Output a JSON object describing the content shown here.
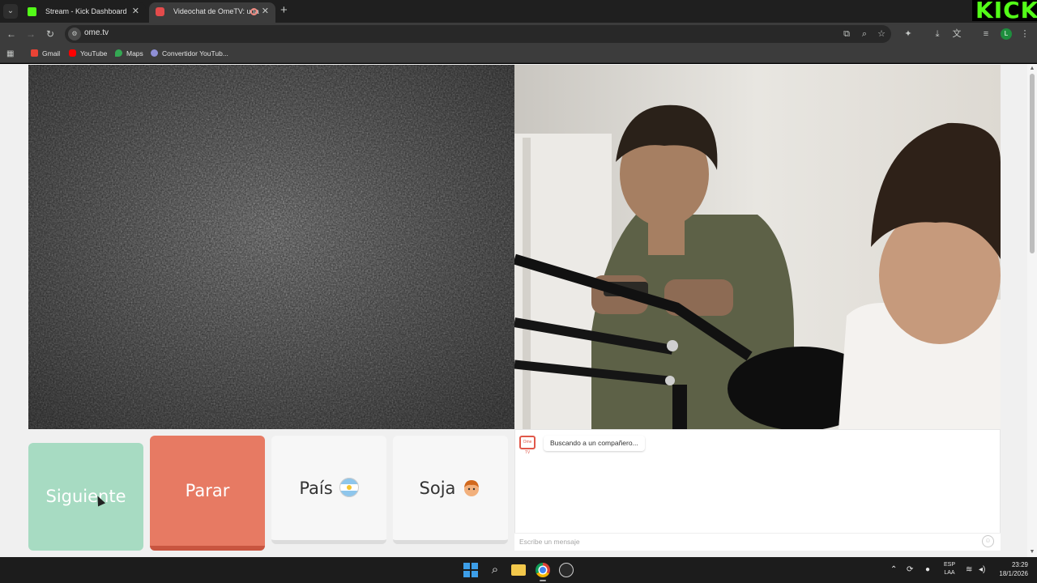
{
  "browser": {
    "tabs": [
      {
        "title": "Stream - Kick Dashboard",
        "active": false
      },
      {
        "title": "Videochat de OmeTV: una",
        "active": true
      }
    ],
    "url": "ome.tv",
    "bookmarks": [
      "Gmail",
      "YouTube",
      "Maps",
      "Convertidor YouTub..."
    ],
    "profile_initial": "L",
    "kick_badge": "KICK"
  },
  "controls": {
    "next_label": "Siguiente",
    "stop_label": "Parar",
    "country_label": "País",
    "gender_label": "Soja"
  },
  "chat": {
    "status": "Buscando a un compañero...",
    "input_placeholder": "Escribe un mensaje",
    "logo_text": "Ome TV"
  },
  "taskbar": {
    "lang_top": "ESP",
    "lang_bottom": "LAA",
    "time": "23:29",
    "date": "18/1/2026"
  },
  "colors": {
    "next": "#a7dbc2",
    "stop": "#e77a63",
    "kick_green": "#53fc18"
  }
}
